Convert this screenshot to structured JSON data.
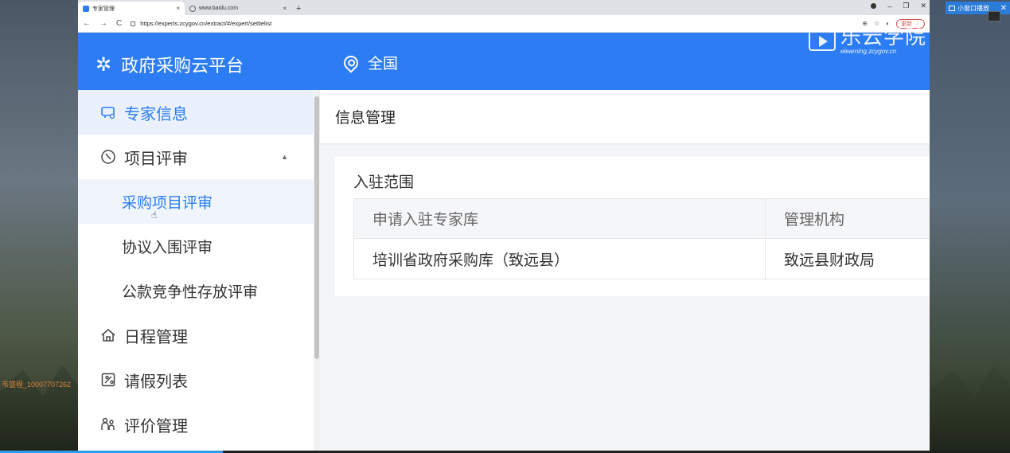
{
  "desktop": {
    "watermark": "韦盛程_10007707262",
    "mini_window_label": "小窗口播放",
    "mini_window_close": "✕"
  },
  "browser": {
    "tabs": [
      {
        "title": "专家管理",
        "close": "×"
      },
      {
        "title": "www.baidu.com",
        "close": "×"
      }
    ],
    "new_tab": "+",
    "window_controls": {
      "minimize": "–",
      "maximize": "❐",
      "close": "✕"
    },
    "nav": {
      "back": "←",
      "forward": "→",
      "reload": "C"
    },
    "url": "https://experts.zcygov.cn/extract/#/expert/settlelist",
    "update_label": "更新",
    "menu_dots": "⋮"
  },
  "app": {
    "brand_title": "政府采购云平台",
    "brand_icon": "✲",
    "location": "全国",
    "edu_logo_cn": "乐云学院",
    "edu_logo_en": "elearning.zcygov.cn",
    "sidebar": {
      "items": [
        {
          "label": "专家信息",
          "icon": "expert-card-icon"
        },
        {
          "label": "项目评审",
          "icon": "review-icon",
          "arrow": "▲"
        },
        {
          "label": "采购项目评审"
        },
        {
          "label": "协议入围评审"
        },
        {
          "label": "公款竞争性存放评审"
        },
        {
          "label": "日程管理",
          "icon": "home-icon"
        },
        {
          "label": "请假列表",
          "icon": "leave-icon"
        },
        {
          "label": "评价管理",
          "icon": "evaluation-icon"
        }
      ]
    },
    "main": {
      "page_title": "信息管理",
      "section_title": "入驻范围",
      "table": {
        "headers": [
          "申请入驻专家库",
          "管理机构"
        ],
        "rows": [
          [
            "培训省政府采购库（致远县）",
            "致远县财政局"
          ]
        ]
      }
    }
  }
}
